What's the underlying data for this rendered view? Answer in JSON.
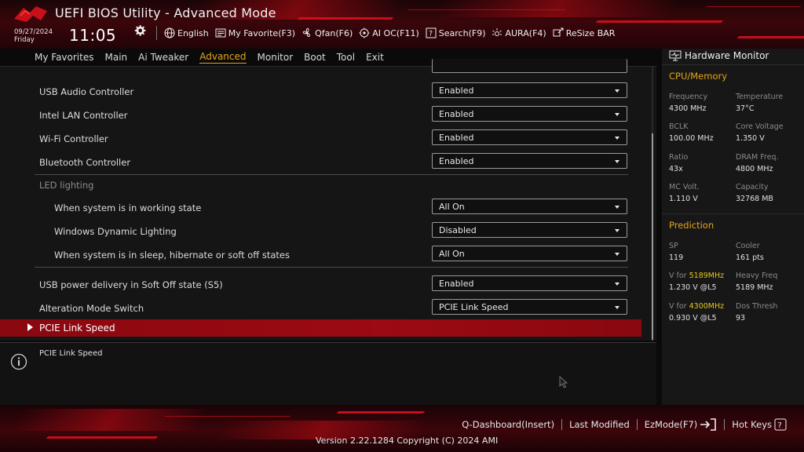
{
  "colors": {
    "accent": "#e6a517",
    "highlight_row": "#9c0a12",
    "brand_red": "#e0101c"
  },
  "header": {
    "title": "UEFI BIOS Utility - Advanced Mode",
    "date": "09/27/2024",
    "weekday": "Friday",
    "time": "11:05",
    "toolbar": {
      "language": "English",
      "my_favorite": "My Favorite(F3)",
      "qfan": "Qfan(F6)",
      "ai_oc": "AI OC(F11)",
      "search": "Search(F9)",
      "aura": "AURA(F4)",
      "resize_bar": "ReSize BAR"
    }
  },
  "menu": [
    "My Favorites",
    "Main",
    "Ai Tweaker",
    "Advanced",
    "Monitor",
    "Boot",
    "Tool",
    "Exit"
  ],
  "menu_active": "Advanced",
  "settings": {
    "usb_audio": {
      "label": "USB Audio Controller",
      "value": "Enabled"
    },
    "intel_lan": {
      "label": "Intel LAN Controller",
      "value": "Enabled"
    },
    "wifi": {
      "label": "Wi-Fi Controller",
      "value": "Enabled"
    },
    "bluetooth": {
      "label": "Bluetooth Controller",
      "value": "Enabled"
    },
    "led_section": "LED lighting",
    "led_working": {
      "label": "When system is in working state",
      "value": "All On"
    },
    "led_dynamic": {
      "label": "Windows Dynamic Lighting",
      "value": "Disabled"
    },
    "led_sleep": {
      "label": "When system is in sleep, hibernate or soft off states",
      "value": "All On"
    },
    "usb_power": {
      "label": "USB power delivery in Soft Off state (S5)",
      "value": "Enabled"
    },
    "alt_mode": {
      "label": "Alteration Mode Switch",
      "value": "PCIE Link Speed"
    },
    "pcie_link": {
      "label": "PCIE Link Speed"
    }
  },
  "help": {
    "text": "PCIE Link Speed"
  },
  "hardware_monitor": {
    "title": "Hardware Monitor",
    "cpu_memory": {
      "title": "CPU/Memory",
      "frequency": {
        "label": "Frequency",
        "value": "4300 MHz"
      },
      "temperature": {
        "label": "Temperature",
        "value": "37°C"
      },
      "bclk": {
        "label": "BCLK",
        "value": "100.00 MHz"
      },
      "core_voltage": {
        "label": "Core Voltage",
        "value": "1.350 V"
      },
      "ratio": {
        "label": "Ratio",
        "value": "43x"
      },
      "dram_freq": {
        "label": "DRAM Freq.",
        "value": "4800 MHz"
      },
      "mc_volt": {
        "label": "MC Volt.",
        "value": "1.110 V"
      },
      "capacity": {
        "label": "Capacity",
        "value": "32768 MB"
      }
    },
    "prediction": {
      "title": "Prediction",
      "sp": {
        "label": "SP",
        "value": "119"
      },
      "cooler": {
        "label": "Cooler",
        "value": "161 pts"
      },
      "v_for_1": {
        "label_prefix": "V for ",
        "label_freq": "5189MHz",
        "value": "1.230 V @L5"
      },
      "heavy_freq": {
        "label": "Heavy Freq",
        "value": "5189 MHz"
      },
      "v_for_2": {
        "label_prefix": "V for ",
        "label_freq": "4300MHz",
        "value": "0.930 V @L5"
      },
      "dos_thresh": {
        "label": "Dos Thresh",
        "value": "93"
      }
    }
  },
  "footer": {
    "q_dashboard": "Q-Dashboard(Insert)",
    "last_modified": "Last Modified",
    "ezmode": "EzMode(F7)",
    "hot_keys": "Hot Keys",
    "version": "Version 2.22.1284 Copyright (C) 2024 AMI"
  }
}
